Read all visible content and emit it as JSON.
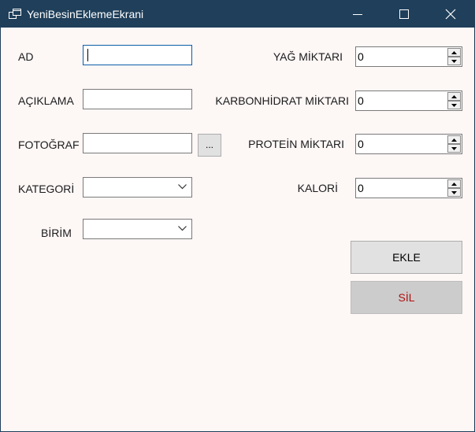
{
  "window": {
    "title": "YeniBesinEklemeEkrani",
    "colors": {
      "titlebar": "#1f3f5a",
      "client": "#fdf7f6",
      "delete_text": "#b00f0f"
    },
    "icons": {
      "app": "windows-form-icon",
      "minimize": "minimize-icon",
      "maximize": "maximize-icon",
      "close": "close-icon"
    }
  },
  "form": {
    "left": {
      "ad_label": "AD",
      "aciklama_label": "AÇIKLAMA",
      "fotograf_label": "FOTOĞRAF",
      "browse_label": "...",
      "kategori_label": "KATEGORİ",
      "birim_label": "BİRİM"
    },
    "right": {
      "yag_label": "YAĞ MİKTARI",
      "yag_value": "0",
      "karbonhidrat_label": "KARBONHİDRAT MİKTARI",
      "karbonhidrat_value": "0",
      "protein_label": "PROTEİN MİKTARI",
      "protein_value": "0",
      "kalori_label": "KALORİ",
      "kalori_value": "0"
    },
    "buttons": {
      "add_label": "EKLE",
      "delete_label": "SİL"
    }
  }
}
